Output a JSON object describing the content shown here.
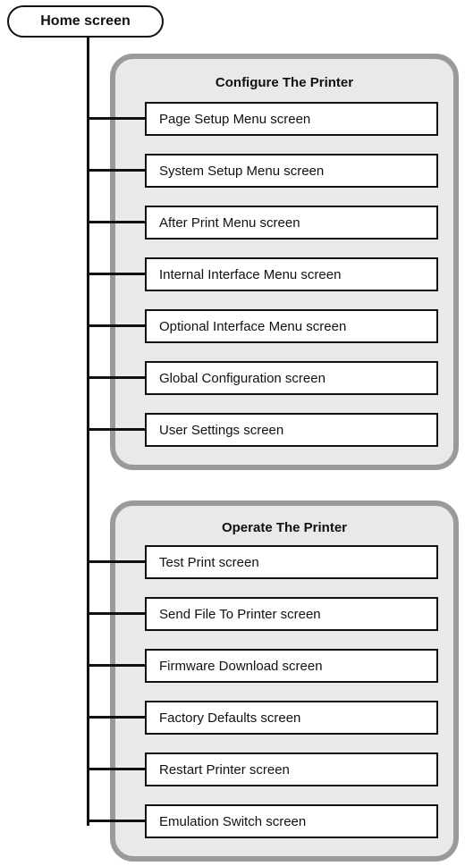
{
  "root": {
    "label": "Home screen"
  },
  "groups": [
    {
      "title": "Configure The Printer",
      "items": [
        "Page Setup Menu screen",
        "System Setup Menu screen",
        "After Print Menu screen",
        "Internal Interface Menu screen",
        "Optional Interface Menu screen",
        "Global Configuration screen",
        "User Settings screen"
      ]
    },
    {
      "title": "Operate The Printer",
      "items": [
        "Test Print screen",
        "Send File To Printer screen",
        "Firmware Download screen",
        "Factory Defaults screen",
        "Restart Printer screen",
        "Emulation Switch screen"
      ]
    }
  ]
}
